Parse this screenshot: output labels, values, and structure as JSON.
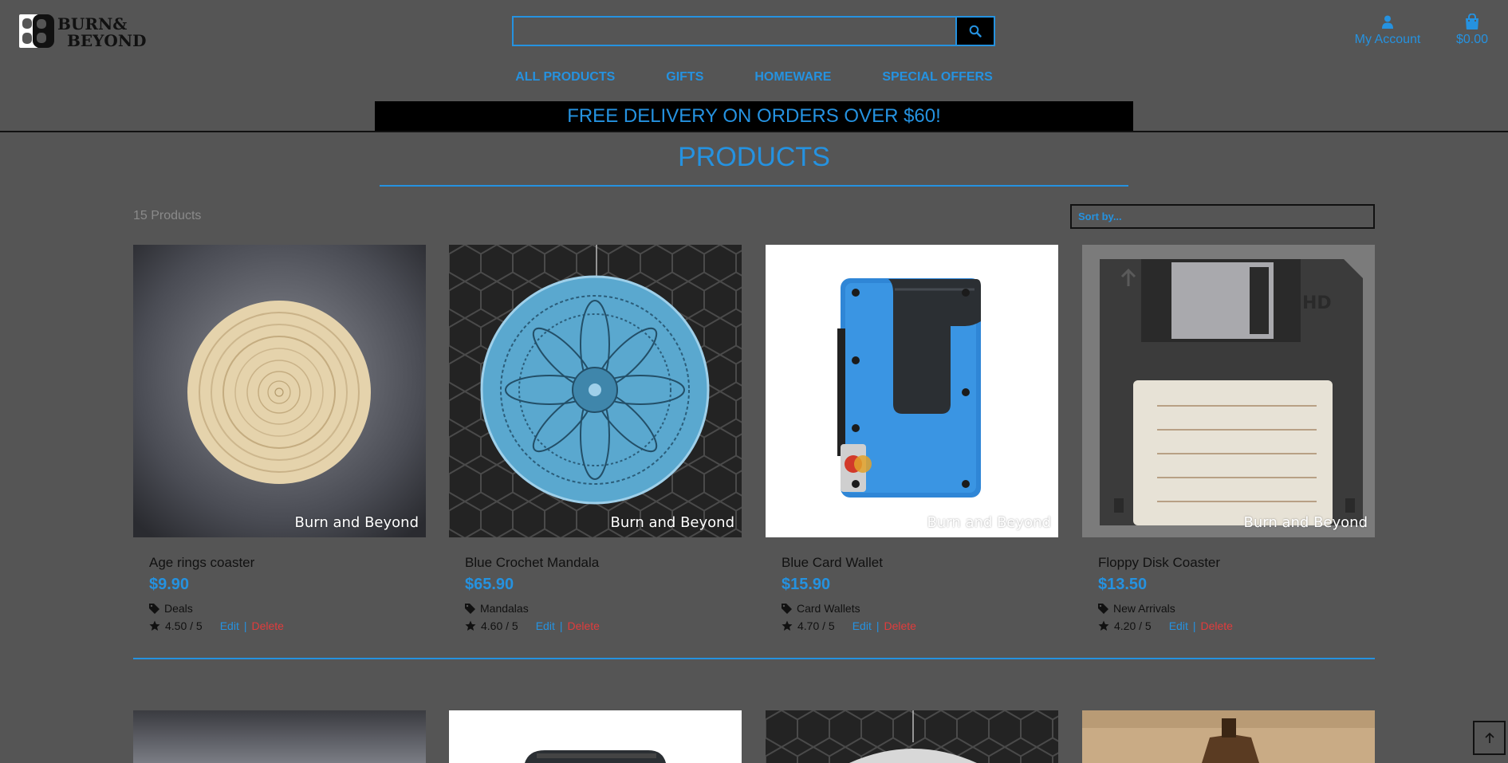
{
  "brand": {
    "logo_mark": "BB",
    "logo_line1": "BURN&",
    "logo_line2": "BEYOND"
  },
  "search": {
    "placeholder": "",
    "value": ""
  },
  "account": {
    "label": "My Account",
    "icon": "user-icon"
  },
  "cart": {
    "total": "$0.00",
    "icon": "shopping-bag-icon"
  },
  "nav": {
    "items": [
      {
        "label": "ALL PRODUCTS"
      },
      {
        "label": "GIFTS"
      },
      {
        "label": "HOMEWARE"
      },
      {
        "label": "SPECIAL OFFERS"
      }
    ]
  },
  "banner": {
    "text": "FREE DELIVERY ON ORDERS OVER $60!"
  },
  "main": {
    "title": "PRODUCTS",
    "count": "15 Products",
    "sort_label": "Sort by..."
  },
  "products": [
    {
      "name": "Age rings coaster",
      "price": "$9.90",
      "category": "Deals",
      "rating": "4.50 / 5",
      "watermark": "Burn and Beyond",
      "edit": "Edit",
      "sep": "|",
      "delete": "Delete"
    },
    {
      "name": "Blue Crochet Mandala",
      "price": "$65.90",
      "category": "Mandalas",
      "rating": "4.60 / 5",
      "watermark": "Burn and Beyond",
      "edit": "Edit",
      "sep": "|",
      "delete": "Delete"
    },
    {
      "name": "Blue Card Wallet",
      "price": "$15.90",
      "category": "Card Wallets",
      "rating": "4.70 / 5",
      "watermark": "Burn and Beyond",
      "edit": "Edit",
      "sep": "|",
      "delete": "Delete"
    },
    {
      "name": "Floppy Disk Coaster",
      "price": "$13.50",
      "category": "New Arrivals",
      "rating": "4.20 / 5",
      "watermark": "Burn and Beyond",
      "edit": "Edit",
      "sep": "|",
      "delete": "Delete"
    }
  ],
  "colors": {
    "accent": "#2592e0",
    "background": "#555555",
    "danger": "#e03c3c"
  }
}
